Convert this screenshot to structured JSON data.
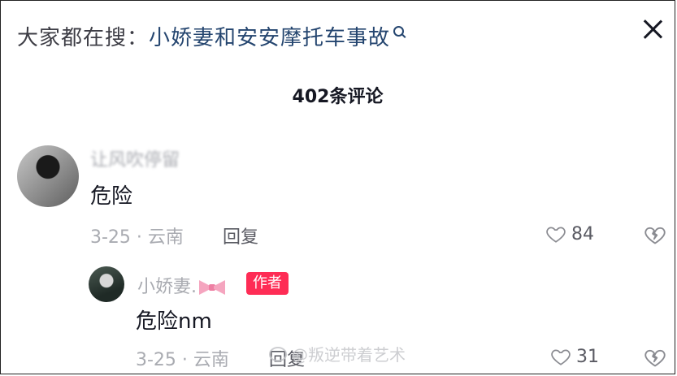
{
  "header": {
    "search_prefix": "大家都在搜：",
    "search_query": "小娇妻和安安摩托车事故",
    "search_icon": "search-icon",
    "close_icon": "close-icon"
  },
  "comments": {
    "count_label": "402条评论",
    "main": {
      "username": "让风吹停留",
      "text": "危险",
      "meta": "3-25 · 云南",
      "reply_label": "回复",
      "likes": "84"
    },
    "reply": {
      "username": "小娇妻.",
      "badge": "作者",
      "text": "危险nm",
      "meta": "3-25 · 云南",
      "reply_label": "回复",
      "likes": "31"
    }
  },
  "watermark": {
    "text": "@叛逆带着艺术"
  },
  "colors": {
    "accent": "#fe2c55",
    "query": "#24456f",
    "muted": "#a9abb1"
  }
}
